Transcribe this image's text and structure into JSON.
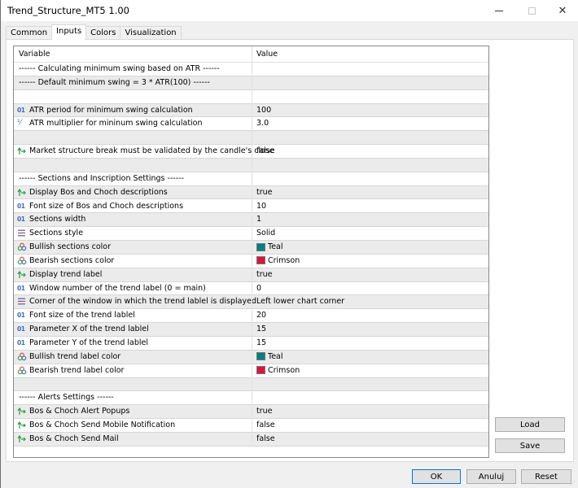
{
  "window": {
    "title": "Trend_Structure_MT5 1.00",
    "controls": {
      "minimize": "minimize",
      "maximize": "maximize",
      "close": "close"
    }
  },
  "tabs": [
    {
      "label": "Common",
      "active": false
    },
    {
      "label": "Inputs",
      "active": true
    },
    {
      "label": "Colors",
      "active": false
    },
    {
      "label": "Visualization",
      "active": false
    }
  ],
  "grid": {
    "headers": {
      "variable": "Variable",
      "value": "Value"
    },
    "rows": [
      {
        "icon": "none",
        "variable": "------   Calculating minimum swing based on ATR   ------",
        "value": ""
      },
      {
        "icon": "none",
        "variable": "------   Default minimum swing = 3 * ATR(100)   ------",
        "value": ""
      },
      {
        "icon": "none",
        "variable": "",
        "value": ""
      },
      {
        "icon": "int",
        "variable": "ATR period for minimum swing calculation",
        "value": "100"
      },
      {
        "icon": "double",
        "variable": "ATR multiplier for mininum swing calculation",
        "value": "3.0"
      },
      {
        "icon": "none",
        "variable": "",
        "value": ""
      },
      {
        "icon": "bool",
        "variable": "Market structure break must be validated by the candle's close",
        "value": "false"
      },
      {
        "icon": "none",
        "variable": "",
        "value": ""
      },
      {
        "icon": "none",
        "variable": "------   Sections and Inscription Settings   ------",
        "value": ""
      },
      {
        "icon": "bool",
        "variable": "Display Bos and Choch descriptions",
        "value": "true"
      },
      {
        "icon": "int",
        "variable": "Font size of Bos and Choch descriptions",
        "value": "10"
      },
      {
        "icon": "int",
        "variable": "Sections width",
        "value": "1"
      },
      {
        "icon": "enum",
        "variable": "Sections style",
        "value": "Solid"
      },
      {
        "icon": "color",
        "variable": "Bullish sections color",
        "value": "Teal",
        "swatch": "#008080"
      },
      {
        "icon": "color",
        "variable": "Bearish sections color",
        "value": "Crimson",
        "swatch": "#dc143c"
      },
      {
        "icon": "bool",
        "variable": "Display trend label",
        "value": "true"
      },
      {
        "icon": "int",
        "variable": "Window number of the trend label (0 = main)",
        "value": "0"
      },
      {
        "icon": "enum",
        "variable": "Corner of the window in which the trend lablel is displayed",
        "value": "Left lower chart corner"
      },
      {
        "icon": "int",
        "variable": "Font size of the trend lablel",
        "value": "20"
      },
      {
        "icon": "int",
        "variable": "Parameter X of the trend lablel",
        "value": "15"
      },
      {
        "icon": "int",
        "variable": "Parameter Y of the trend lablel",
        "value": "15"
      },
      {
        "icon": "color",
        "variable": "Bullish trend label color",
        "value": "Teal",
        "swatch": "#008080"
      },
      {
        "icon": "color",
        "variable": "Bearish trend label color",
        "value": "Crimson",
        "swatch": "#dc143c"
      },
      {
        "icon": "none",
        "variable": "",
        "value": ""
      },
      {
        "icon": "none",
        "variable": "------   Alerts Settings   ------",
        "value": ""
      },
      {
        "icon": "bool",
        "variable": "Bos & Choch Alert Popups",
        "value": "true"
      },
      {
        "icon": "bool",
        "variable": "Bos & Choch Send Mobile Notification",
        "value": "false"
      },
      {
        "icon": "bool",
        "variable": "Bos & Choch Send Mail",
        "value": "false"
      }
    ]
  },
  "side_buttons": {
    "load": "Load",
    "save": "Save"
  },
  "footer_buttons": {
    "ok": "OK",
    "cancel": "Anuluj",
    "reset": "Reset"
  },
  "colors": {
    "accent_focus": "#0078d7",
    "int_icon": "#3b6fb6",
    "bool_icon": "#2e9e4a"
  }
}
